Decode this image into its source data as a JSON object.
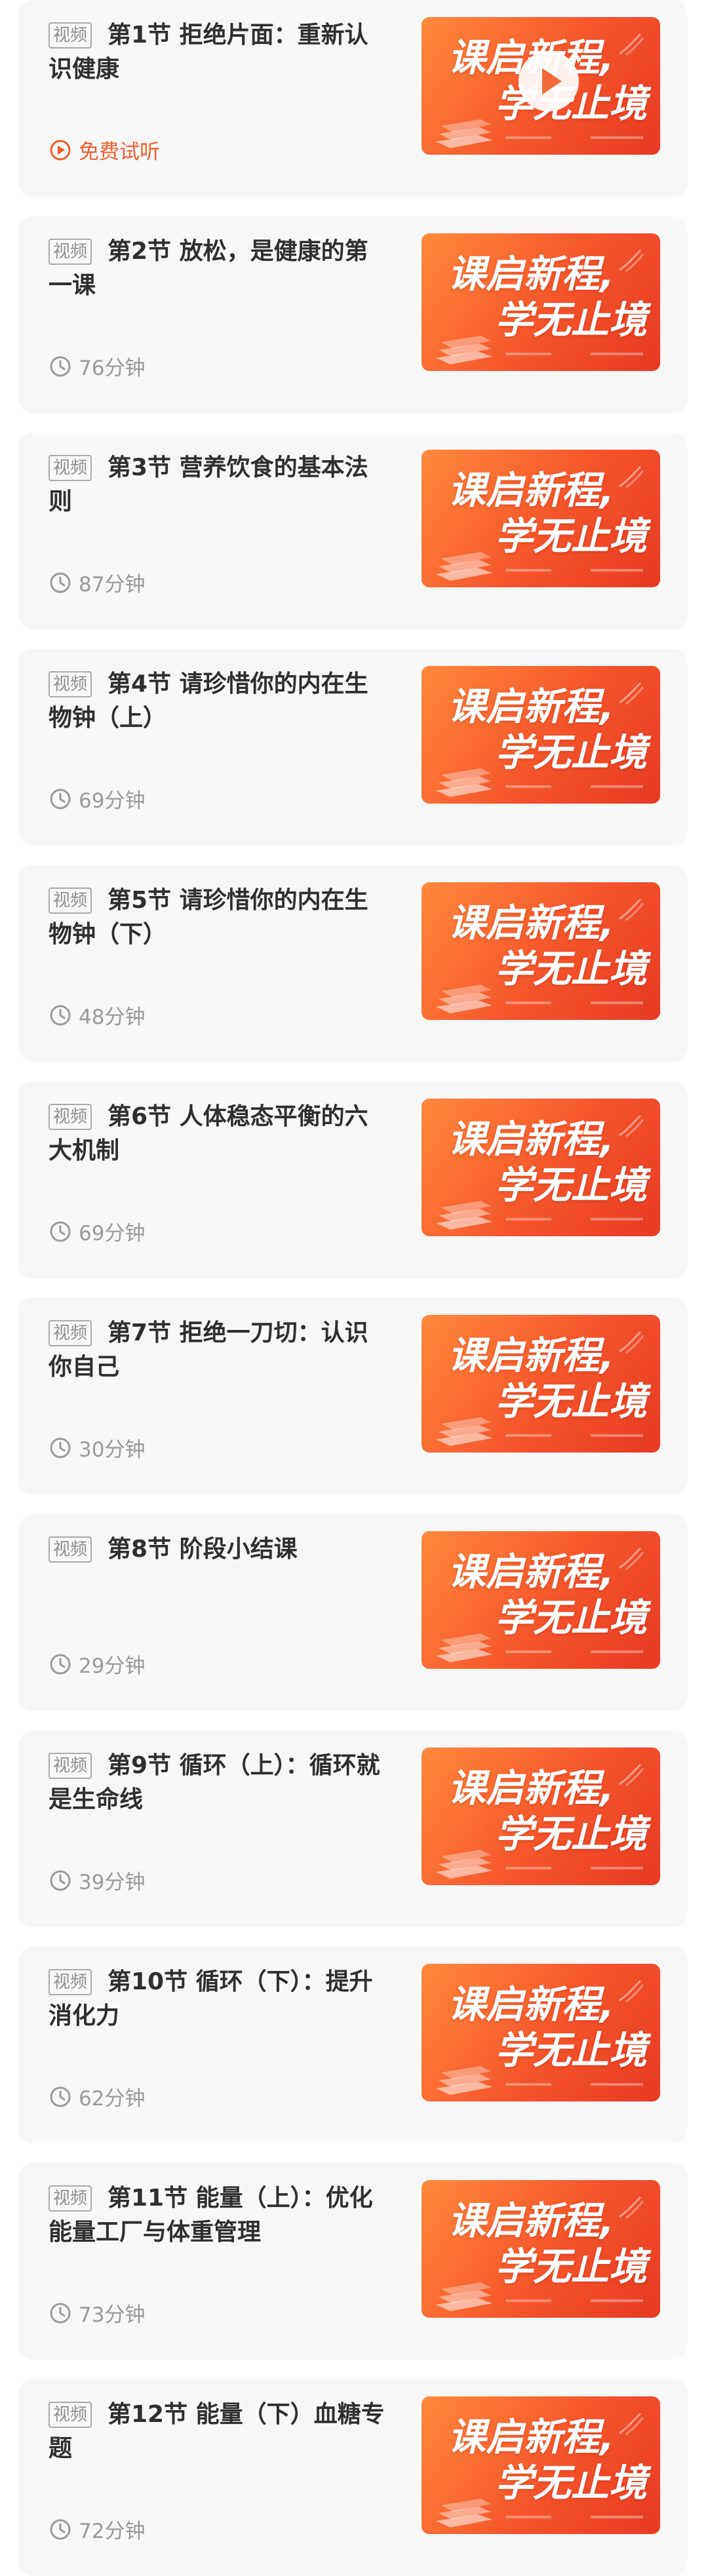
{
  "tag_label": "视频",
  "thumbnail": {
    "line1": "课启新程,",
    "line2": "学无止境"
  },
  "lessons": [
    {
      "title": "第1节 拒绝片面：重新认识健康",
      "meta": "免费试听",
      "free": true
    },
    {
      "title": "第2节 放松，是健康的第一课",
      "meta": "76分钟",
      "free": false
    },
    {
      "title": "第3节 营养饮食的基本法则",
      "meta": "87分钟",
      "free": false
    },
    {
      "title": "第4节 请珍惜你的内在生物钟（上）",
      "meta": "69分钟",
      "free": false
    },
    {
      "title": "第5节 请珍惜你的内在生物钟（下）",
      "meta": "48分钟",
      "free": false
    },
    {
      "title": "第6节 人体稳态平衡的六大机制",
      "meta": "69分钟",
      "free": false
    },
    {
      "title": "第7节 拒绝一刀切：认识你自己",
      "meta": "30分钟",
      "free": false
    },
    {
      "title": "第8节 阶段小结课",
      "meta": "29分钟",
      "free": false
    },
    {
      "title": "第9节 循环（上）：循环就是生命线",
      "meta": "39分钟",
      "free": false
    },
    {
      "title": "第10节 循环（下）：提升消化力",
      "meta": "62分钟",
      "free": false
    },
    {
      "title": "第11节 能量（上）：优化能量工厂与体重管理",
      "meta": "73分钟",
      "free": false
    },
    {
      "title": "第12节 能量（下）血糖专题",
      "meta": "72分钟",
      "free": false
    }
  ]
}
